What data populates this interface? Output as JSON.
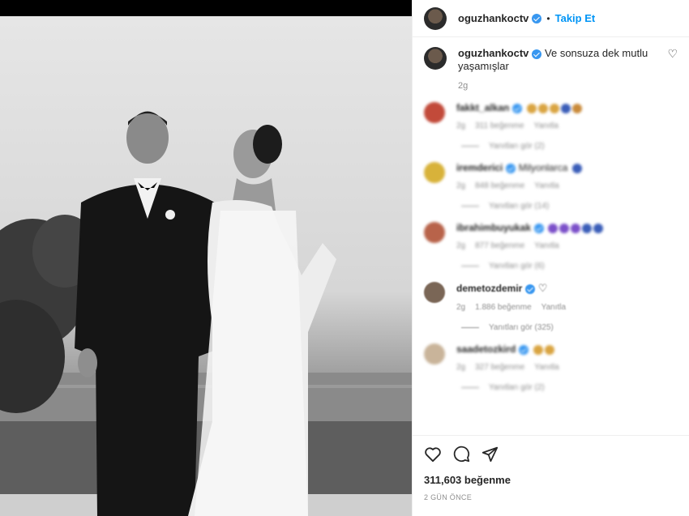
{
  "post": {
    "username": "oguzhankoctv",
    "follow_label": "Takip Et",
    "dot": "•",
    "caption": "Ve sonsuza dek mutlu yaşamışlar",
    "caption_time": "2g",
    "likes": "311,603 beğenme",
    "posted_ago": "2 GÜN ÖNCE",
    "image_alt": "black and white wedding photo of couple"
  },
  "comments": [
    {
      "username": "fakkt_alkan",
      "time": "2g",
      "likes": "311 beğenme",
      "reply": "Yanıtla",
      "view_replies": "Yanıtları gör (2)",
      "emoji_colors": [
        "#d9a441",
        "#d9a441",
        "#d9a441",
        "#3a5db8",
        "#c98a3a"
      ]
    },
    {
      "username": "iremderici",
      "text": "Milyonlarca",
      "time": "2g",
      "likes": "848 beğenme",
      "reply": "Yanıtla",
      "view_replies": "Yanıtları gör (14)",
      "emoji_colors": [
        "#3a5db8"
      ]
    },
    {
      "username": "ibrahimbuyukak",
      "time": "2g",
      "likes": "877 beğenme",
      "reply": "Yanıtla",
      "view_replies": "Yanıtları gör (6)",
      "emoji_colors": [
        "#7b4fc9",
        "#7b4fc9",
        "#7b4fc9",
        "#3a5db8",
        "#3a5db8"
      ]
    },
    {
      "username": "demetozdemir",
      "time": "2g",
      "likes": "1.886 beğenme",
      "reply": "Yanıtla",
      "view_replies": "Yanıtları gör (325)",
      "emoji_colors": []
    },
    {
      "username": "saadetozkird",
      "time": "2g",
      "likes": "327 beğenme",
      "reply": "Yanıtla",
      "view_replies": "Yanıtları gör (2)",
      "emoji_colors": [
        "#d9a441",
        "#d9a441"
      ]
    }
  ]
}
